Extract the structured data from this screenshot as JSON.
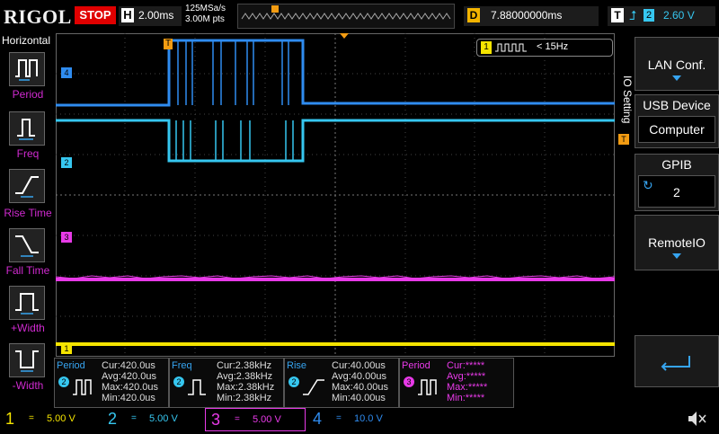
{
  "header": {
    "brand": "RIGOL",
    "run_state": "STOP",
    "timebase_key": "H",
    "timebase": "2.00ms",
    "sample_rate": "125MSa/s",
    "memory_depth": "3.00M pts",
    "delay_key": "D",
    "delay": "7.88000000ms",
    "trigger_key": "T",
    "trigger_source": "2",
    "trigger_level": "2.60 V"
  },
  "left_panel": {
    "title": "Horizontal",
    "items": [
      {
        "label": "Period"
      },
      {
        "label": "Freq"
      },
      {
        "label": "Rise Time"
      },
      {
        "label": "Fall Time"
      },
      {
        "label": "+Width"
      },
      {
        "label": "-Width"
      }
    ]
  },
  "screen": {
    "trigger_marker": "T",
    "freq_badge_channel": "1",
    "freq_badge_text": "< 15Hz",
    "channel_markers": [
      "4",
      "2",
      "3",
      "1"
    ]
  },
  "right_panel": {
    "tab_label": "IO Setting",
    "lan_label": "LAN Conf.",
    "usb_title": "USB Device",
    "usb_value": "Computer",
    "gpib_title": "GPIB",
    "gpib_value": "2",
    "remote_label": "RemoteIO"
  },
  "measurements": [
    {
      "name": "Period",
      "channel": "2",
      "cur": "Cur:420.0us",
      "avg": "Avg:420.0us",
      "max": "Max:420.0us",
      "min": "Min:420.0us"
    },
    {
      "name": "Freq",
      "channel": "2",
      "cur": "Cur:2.38kHz",
      "avg": "Avg:2.38kHz",
      "max": "Max:2.38kHz",
      "min": "Min:2.38kHz"
    },
    {
      "name": "Rise",
      "channel": "2",
      "cur": "Cur:40.00us",
      "avg": "Avg:40.00us",
      "max": "Max:40.00us",
      "min": "Min:40.00us"
    },
    {
      "name": "Period",
      "channel": "3",
      "cur": "Cur:*****",
      "avg": "Avg:*****",
      "max": "Max:*****",
      "min": "Min:*****"
    }
  ],
  "channels": [
    {
      "num": "1",
      "coupling": "=",
      "scale": "5.00 V",
      "color": "#f5e400"
    },
    {
      "num": "2",
      "coupling": "=",
      "scale": "5.00 V",
      "color": "#36c7f0"
    },
    {
      "num": "3",
      "coupling": "=",
      "scale": "5.00 V",
      "color": "#e83ae8"
    },
    {
      "num": "4",
      "coupling": "=",
      "scale": "10.0 V",
      "color": "#2f8cf0"
    }
  ],
  "colors": {
    "ch1": "#f5e400",
    "ch2": "#36c7f0",
    "ch3": "#e83ae8",
    "ch4": "#2f8cf0",
    "trigger": "#f39c12"
  }
}
